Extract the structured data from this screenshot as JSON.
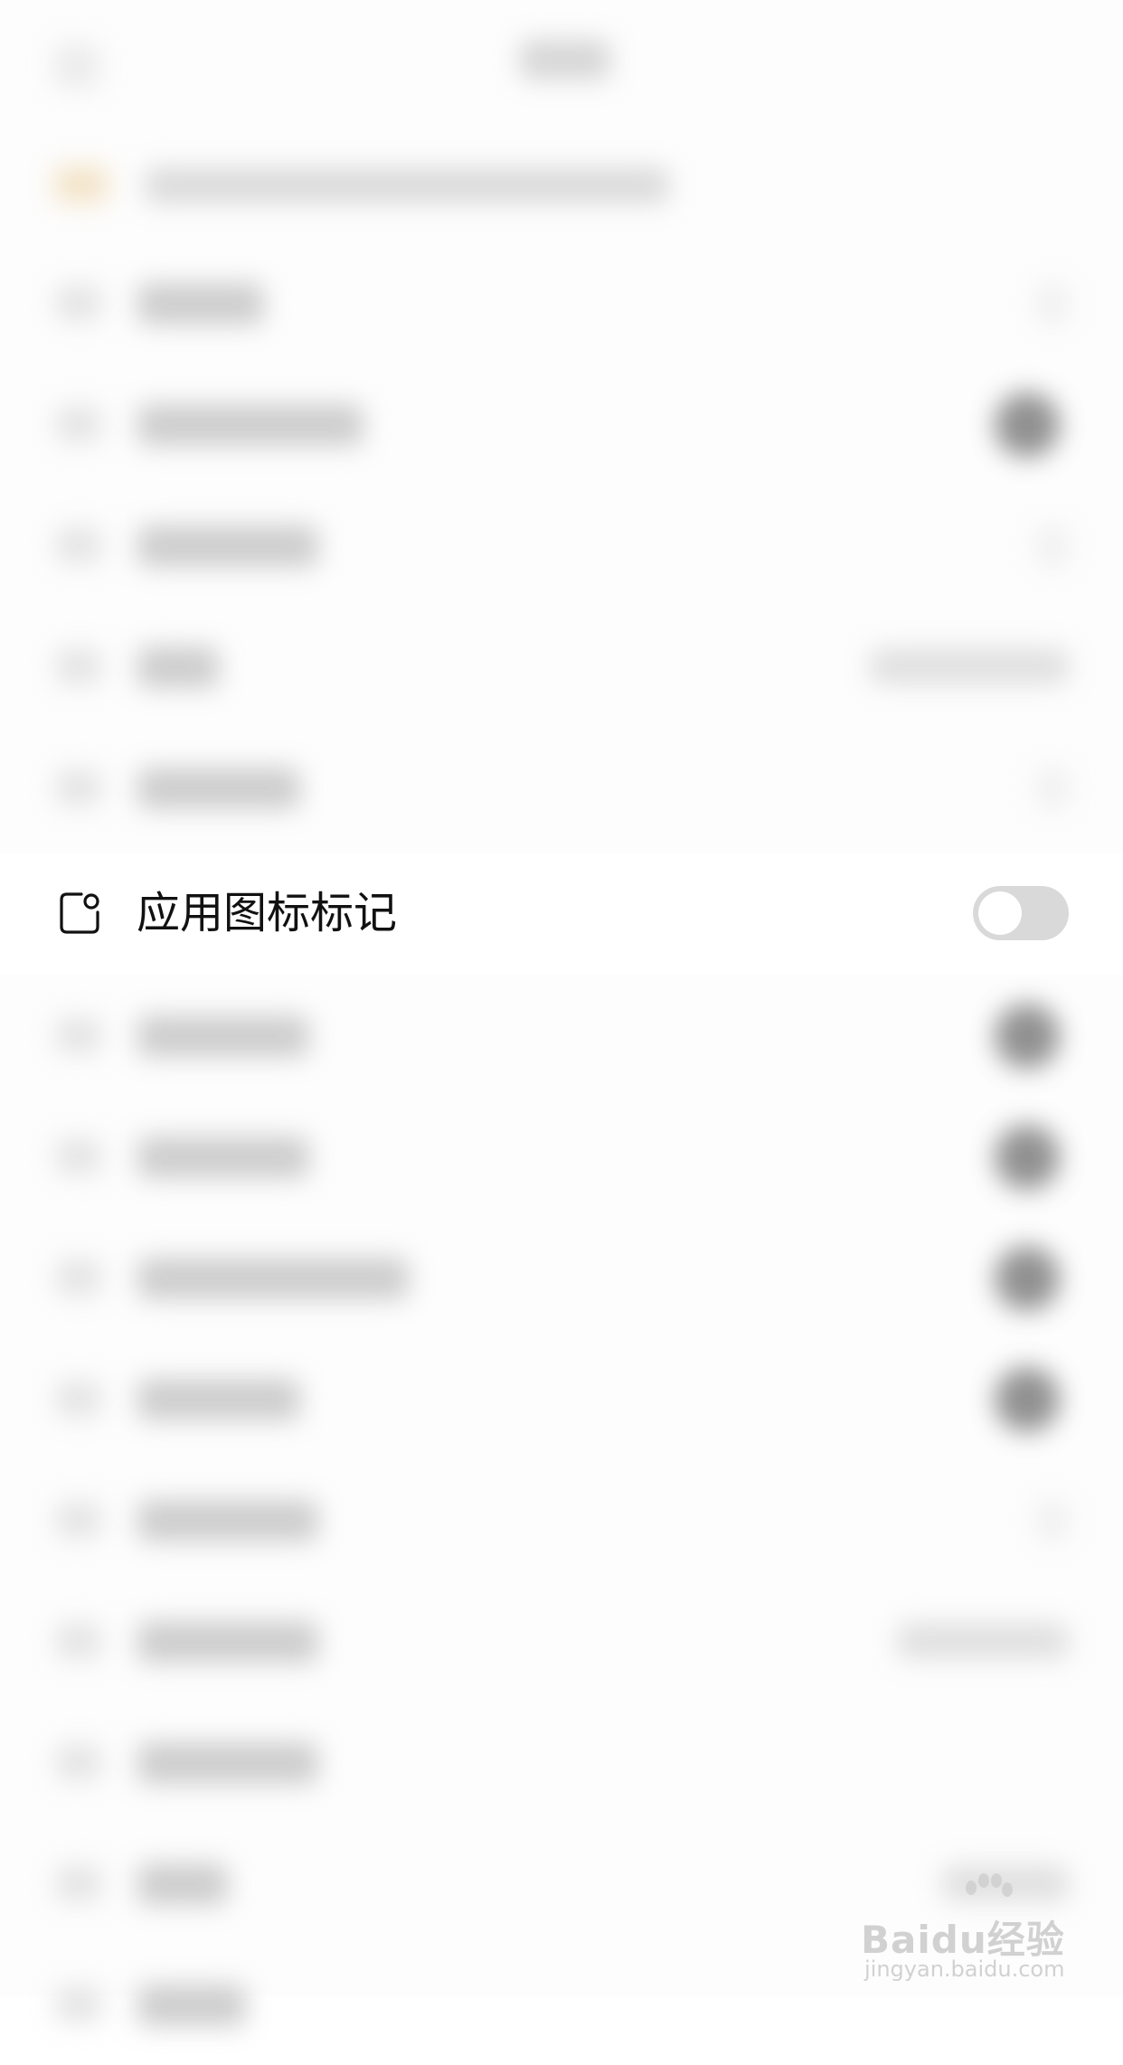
{
  "setting": {
    "label": "应用图标标记",
    "enabled": false
  },
  "watermark": {
    "brand": "Baidu经验",
    "url": "jingyan.baidu.com"
  }
}
